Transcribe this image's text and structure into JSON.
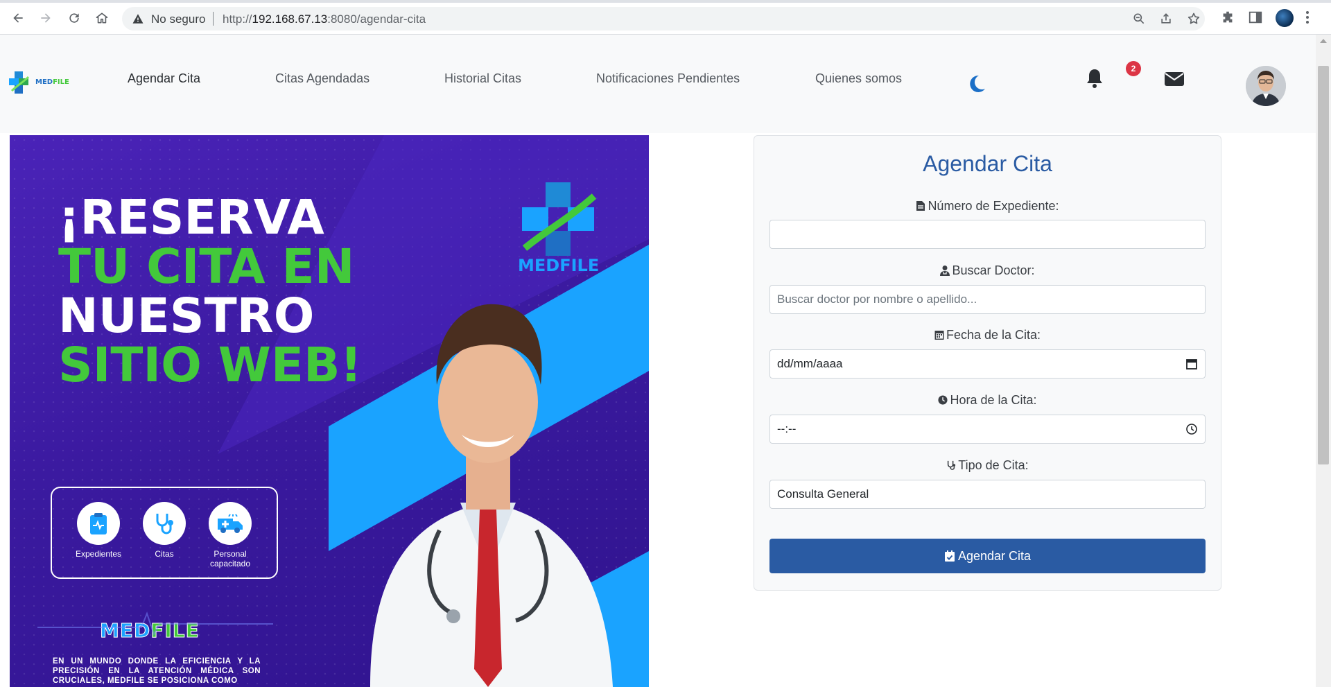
{
  "browser": {
    "insecure_label": "No seguro",
    "url_prefix": "http://",
    "url_host": "192.168.67.13",
    "url_rest": ":8080/agendar-cita"
  },
  "navbar": {
    "logo_text": "MEDFILE",
    "links": [
      {
        "label": "Agendar Cita",
        "active": true
      },
      {
        "label": "Citas Agendadas"
      },
      {
        "label": "Historial Citas"
      },
      {
        "label": "Notificaciones Pendientes"
      },
      {
        "label": "Quienes somos"
      }
    ],
    "notification_count": "2"
  },
  "banner": {
    "headline": [
      "¡RESERVA",
      "TU CITA EN",
      "NUESTRO",
      "SITIO WEB!"
    ],
    "logo_text": "MEDFILE",
    "features": [
      {
        "label": "Expedientes",
        "icon": "clipboard-icon"
      },
      {
        "label": "Citas",
        "icon": "stethoscope-icon"
      },
      {
        "label": "Personal capacitado",
        "icon": "ambulance-icon"
      }
    ],
    "brand_part1": "MED",
    "brand_part2": "FILE",
    "copy": "EN UN MUNDO DONDE LA EFICIENCIA Y LA PRECISIÓN EN LA ATENCIÓN MÉDICA SON CRUCIALES, MEDFILE SE POSICIONA COMO"
  },
  "form": {
    "title": "Agendar Cita",
    "expediente_label": "Número de Expediente:",
    "expediente_value": "",
    "doctor_label": "Buscar Doctor:",
    "doctor_placeholder": "Buscar doctor por nombre o apellido...",
    "fecha_label": "Fecha de la Cita:",
    "fecha_value": "dd/mm/aaaa",
    "hora_label": "Hora de la Cita:",
    "hora_value": "--:--",
    "tipo_label": "Tipo de Cita:",
    "tipo_value": "Consulta General",
    "submit_label": "Agendar Cita"
  },
  "colors": {
    "primary": "#2a5ba3",
    "accent_green": "#43c93b",
    "banner_purple": "#3b1aa0",
    "badge_red": "#dc3545"
  }
}
